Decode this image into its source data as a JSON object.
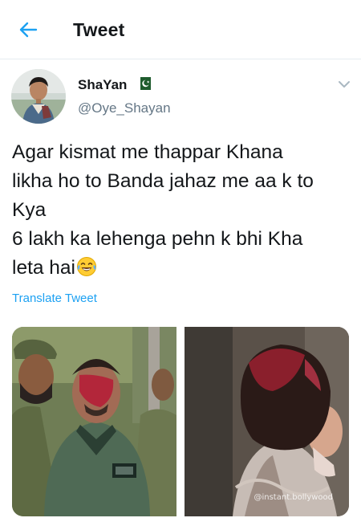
{
  "header": {
    "title": "Tweet",
    "back_icon": "arrow-left-icon"
  },
  "colors": {
    "accent": "#1da1f2",
    "text_primary": "#14171a",
    "text_secondary": "#657786",
    "divider": "#e6ecf0"
  },
  "tweet": {
    "author": {
      "display_name": "ShaYan",
      "handle": "@Oye_Shayan",
      "flag_icon": "pakistan-flag-icon",
      "avatar_icon": "avatar-photo"
    },
    "text_lines": [
      "Agar kismat me thappar Khana",
      "likha ho to Banda jahaz me aa k to",
      "Kya",
      "6 lakh ka lehenga pehn k bhi Kha",
      "leta hai"
    ],
    "emoji_icon": "face-with-tears-of-joy-icon",
    "translate_label": "Translate Tweet",
    "media": [
      {
        "description_icon": "photo-soldiers"
      },
      {
        "description_icon": "photo-woman",
        "watermark": "@instant.bollywood"
      }
    ]
  }
}
